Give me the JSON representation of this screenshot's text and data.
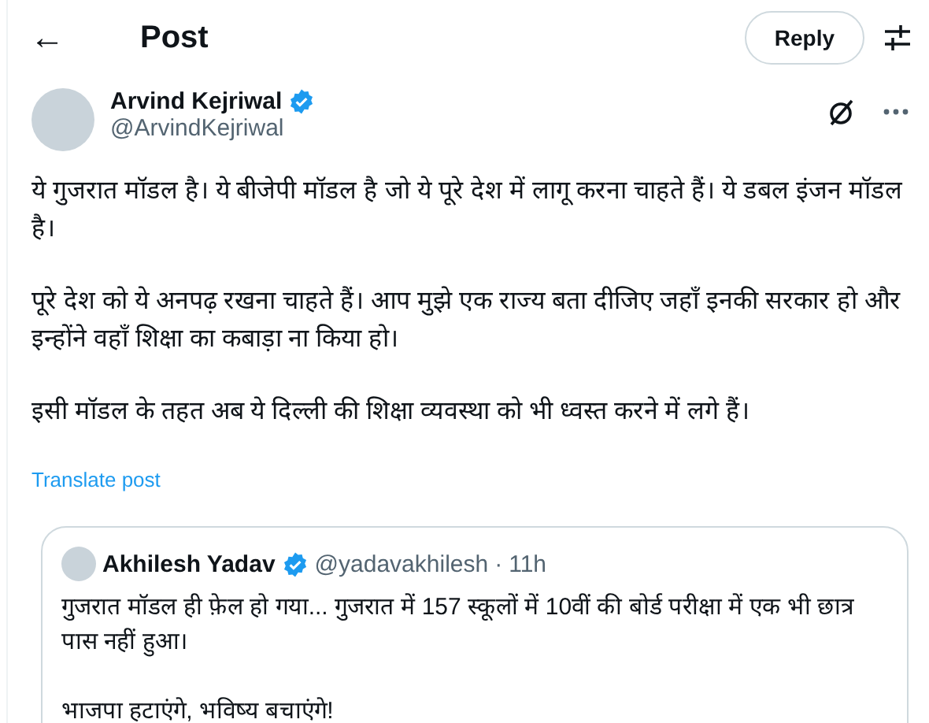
{
  "header": {
    "back_icon": "←",
    "title": "Post",
    "reply_button": "Reply"
  },
  "post": {
    "author": {
      "name": "Arvind Kejriwal",
      "handle": "@ArvindKejriwal",
      "verified": true
    },
    "paragraphs": [
      "ये गुजरात मॉडल है। ये बीजेपी मॉडल है जो ये पूरे देश में लागू करना चाहते हैं। ये डबल इंजन मॉडल है।",
      "पूरे देश को ये अनपढ़ रखना चाहते हैं। आप मुझे एक राज्य बता दीजिए जहाँ इनकी सरकार हो और इन्होंने वहाँ शिक्षा का कबाड़ा ना किया हो।",
      "इसी मॉडल के तहत अब ये दिल्ली की शिक्षा व्यवस्था को भी ध्वस्त करने में लगे हैं।"
    ],
    "translate_link": "Translate post",
    "quote": {
      "author": {
        "name": "Akhilesh Yadav",
        "handle": "@yadavakhilesh",
        "verified": true
      },
      "separator": "·",
      "time": "11h",
      "paragraphs": [
        "गुजरात मॉडल ही फ़ेल हो गया... गुजरात में 157 स्कूलों में 10वीं की बोर्ड परीक्षा में एक भी छात्र पास नहीं हुआ।",
        "भाजपा हटाएंगे, भविष्य बचाएंगे!"
      ]
    }
  }
}
